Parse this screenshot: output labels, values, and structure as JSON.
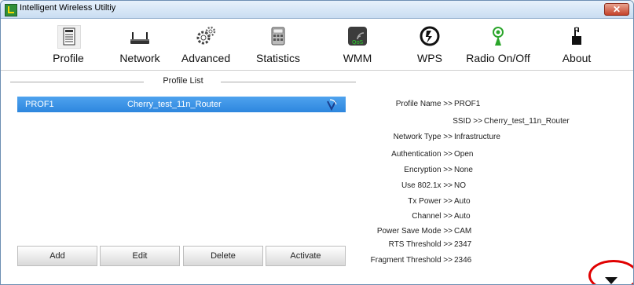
{
  "window": {
    "title": "Intelligent Wireless Utiltiy",
    "close_label": "✕"
  },
  "toolbar": {
    "items": [
      {
        "id": "profile",
        "label": "Profile",
        "icon": "profile-icon"
      },
      {
        "id": "network",
        "label": "Network",
        "icon": "network-icon"
      },
      {
        "id": "advanced",
        "label": "Advanced",
        "icon": "advanced-icon"
      },
      {
        "id": "statistics",
        "label": "Statistics",
        "icon": "statistics-icon"
      },
      {
        "id": "wmm",
        "label": "WMM",
        "icon": "wmm-icon"
      },
      {
        "id": "wps",
        "label": "WPS",
        "icon": "wps-icon"
      },
      {
        "id": "radio",
        "label": "Radio On/Off",
        "icon": "radio-icon"
      },
      {
        "id": "about",
        "label": "About",
        "icon": "about-icon"
      }
    ],
    "active": "Profile"
  },
  "profile_list": {
    "title": "Profile List",
    "rows": [
      {
        "name": "PROF1",
        "ssid": "Cherry_test_11n_Router",
        "icon": "signal-icon"
      }
    ],
    "buttons": [
      "Add",
      "Edit",
      "Delete",
      "Activate"
    ]
  },
  "details": [
    {
      "key": "Profile Name >>",
      "value": "PROF1"
    },
    {
      "key": "SSID >>",
      "value": "Cherry_test_11n_Router"
    },
    {
      "key": "Network Type >>",
      "value": "Infrastructure"
    },
    {
      "key": "Authentication >>",
      "value": "Open"
    },
    {
      "key": "Encryption >>",
      "value": "None"
    },
    {
      "key": "Use 802.1x >>",
      "value": "NO"
    },
    {
      "key": "Tx Power >>",
      "value": "Auto"
    },
    {
      "key": "Channel >>",
      "value": "Auto"
    },
    {
      "key": "Power Save Mode >>",
      "value": "CAM"
    },
    {
      "key": "RTS Threshold >>",
      "value": "2347"
    },
    {
      "key": "Fragment Threshold >>",
      "value": "2346"
    }
  ],
  "colors": {
    "selection": "#2d86de",
    "highlight_ring": "#e00000"
  }
}
